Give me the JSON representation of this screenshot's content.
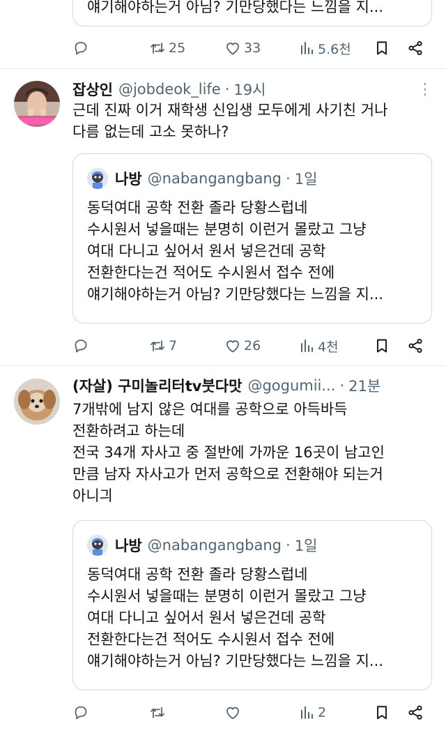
{
  "top_tweet": {
    "quote_last_line": "얘기해야하는거 아님? 기만당했다는 느낌을 지...",
    "actions": {
      "replies": "",
      "retweets": "25",
      "likes": "33",
      "views": "5.6천"
    }
  },
  "tweets": [
    {
      "name": "잡상인",
      "handle": "@jobdeok_life",
      "time": "19시",
      "lines": [
        "근데 진짜 이거 재학생 신입생 모두에게 사기친 거나",
        "다름 없는데 고소 못하나?"
      ],
      "quote": {
        "name": "나방",
        "handle": "@nabangangbang",
        "time": "1일",
        "lines": [
          "동덕여대 공학 전환 졸라 당황스럽네",
          "수시원서 넣을때는 분명히 이런거 몰랐고 그냥",
          "여대 다니고 싶어서 원서 넣은건데 공학",
          "전환한다는건 적어도 수시원서 접수 전에",
          "얘기해야하는거 아님? 기만당했다는 느낌을 지..."
        ]
      },
      "actions": {
        "replies": "",
        "retweets": "7",
        "likes": "26",
        "views": "4천"
      }
    },
    {
      "name": "(자살) 구미놀리터tv붓다맛",
      "handle": "@gogumii...",
      "time": "21분",
      "lines": [
        "7개밖에 남지 않은 여대를 공학으로 아득바득",
        "전환하려고 하는데",
        "전국 34개 자사고 중 절반에 가까운 16곳이 남고인",
        "만큼 남자 자사고가 먼저 공학으로 전환해야 되는거",
        "아니긔"
      ],
      "quote": {
        "name": "나방",
        "handle": "@nabangangbang",
        "time": "1일",
        "lines": [
          "동덕여대 공학 전환 졸라 당황스럽네",
          "수시원서 넣을때는 분명히 이런거 몰랐고 그냥",
          "여대 다니고 싶어서 원서 넣은건데 공학",
          "전환한다는건 적어도 수시원서 접수 전에",
          "얘기해야하는거 아님? 기만당했다는 느낌을 지..."
        ]
      },
      "actions": {
        "replies": "",
        "retweets": "",
        "likes": "",
        "views": "2"
      }
    }
  ],
  "icons": {
    "reply": "reply-icon",
    "retweet": "retweet-icon",
    "like": "heart-icon",
    "views": "views-icon",
    "bookmark": "bookmark-icon",
    "share": "share-icon",
    "more": "more-options-icon"
  },
  "colors": {
    "text": "#0f1419",
    "secondary": "#536471",
    "border": "#cfd9de",
    "divider": "#e6e9ec"
  }
}
